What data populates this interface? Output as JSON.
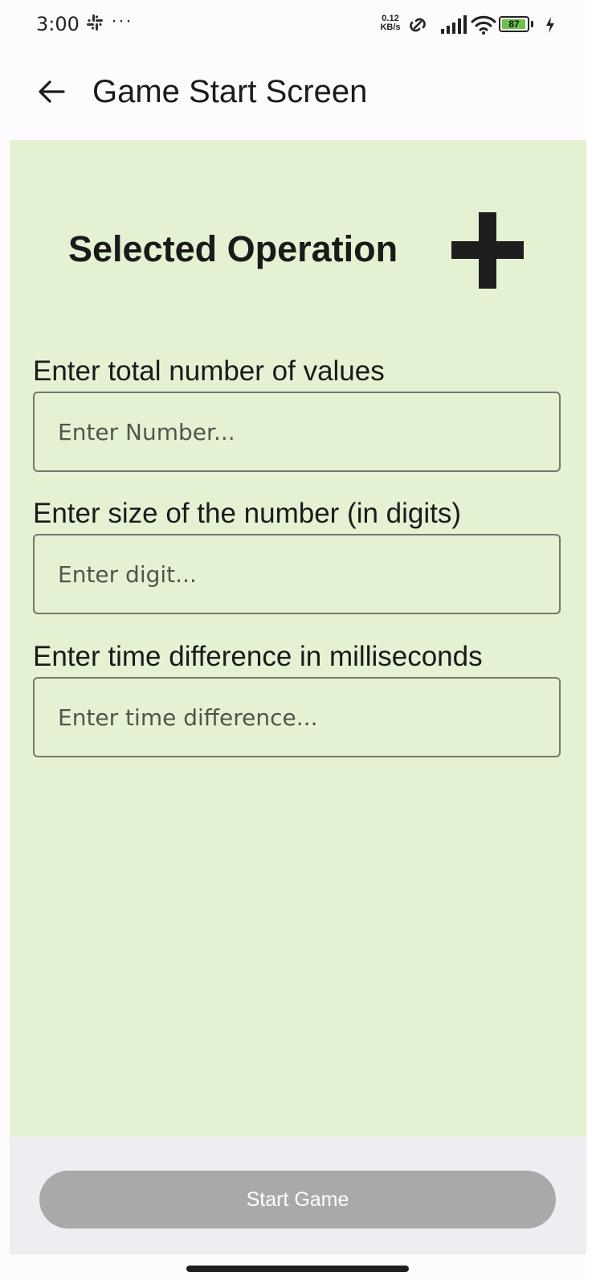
{
  "status_bar": {
    "time": "3:00",
    "more_indicator": "···",
    "speed_value": "0.12",
    "speed_unit": "KB/s",
    "battery_level": "87",
    "icons": [
      "slack-icon",
      "link-icon",
      "signal-icon",
      "wifi-icon",
      "battery-icon",
      "charging-icon"
    ]
  },
  "app_bar": {
    "title": "Game Start Screen",
    "back_icon": "arrow-left-icon"
  },
  "operation": {
    "label": "Selected Operation",
    "symbol": "plus-icon"
  },
  "fields": [
    {
      "label": "Enter total number of values",
      "placeholder": "Enter Number...",
      "value": ""
    },
    {
      "label": "Enter size of the number (in digits)",
      "placeholder": "Enter digit...",
      "value": ""
    },
    {
      "label": "Enter time difference in milliseconds",
      "placeholder": "Enter time difference...",
      "value": ""
    }
  ],
  "start_button": {
    "label": "Start Game"
  },
  "colors": {
    "content_background": "#e4f2d3",
    "bottom_bar_background": "#efecf2",
    "button_disabled": "#a9a9a9",
    "field_border": "#72786c"
  }
}
